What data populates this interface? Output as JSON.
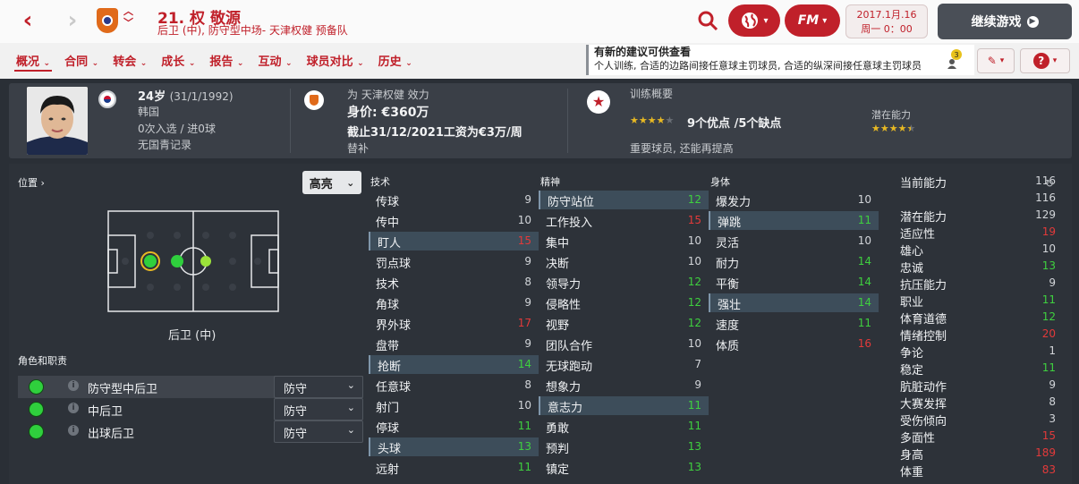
{
  "header": {
    "player_title": "21. 权 敬源",
    "player_subtitle": "后卫 (中), 防守型中场- 天津权健 预备队",
    "brand": "FM",
    "date_line1": "2017.1月.16",
    "date_line2": "周一 0：00",
    "continue_label": "继续游戏"
  },
  "tabs": [
    {
      "label": "概况"
    },
    {
      "label": "合同"
    },
    {
      "label": "转会"
    },
    {
      "label": "成长"
    },
    {
      "label": "报告"
    },
    {
      "label": "互动"
    },
    {
      "label": "球员对比"
    },
    {
      "label": "历史"
    }
  ],
  "notice": {
    "title": "有新的建议可供查看",
    "body": "个人训练, 合适的边路间接任意球主罚球员, 合适的纵深间接任意球主罚球员",
    "count": "3"
  },
  "info": {
    "age": "24岁",
    "dob": "(31/1/1992)",
    "nation": "韩国",
    "caps": "0次入选 / 进0球",
    "youth": "无国青记录",
    "club_line": "为 天津权健 效力",
    "value": "身价: €360万",
    "contract": "截止31/12/2021工资为€3万/周",
    "squad_status": "替补",
    "training_title": "训练概要",
    "strengths": "9个优点 /5个缺点",
    "role_note": "重要球员, 还能再提高",
    "potential_label": "潜在能力",
    "current_stars": 4,
    "potential_stars": 4.5
  },
  "position": {
    "title": "位置 ›",
    "highlight_label": "高亮",
    "position_name": "后卫 (中)",
    "roles_title": "角色和职责",
    "roles": [
      {
        "name": "防守型中后卫",
        "duty": "防守"
      },
      {
        "name": "中后卫",
        "duty": "防守"
      },
      {
        "name": "出球后卫",
        "duty": "防守"
      }
    ]
  },
  "technical": {
    "title": "技术",
    "items": [
      {
        "name": "传球",
        "value": "9",
        "color": "w",
        "hl": false
      },
      {
        "name": "传中",
        "value": "10",
        "color": "w",
        "hl": false
      },
      {
        "name": "盯人",
        "value": "15",
        "color": "r",
        "hl": true
      },
      {
        "name": "罚点球",
        "value": "9",
        "color": "w",
        "hl": false
      },
      {
        "name": "技术",
        "value": "8",
        "color": "w",
        "hl": false
      },
      {
        "name": "角球",
        "value": "9",
        "color": "w",
        "hl": false
      },
      {
        "name": "界外球",
        "value": "17",
        "color": "r",
        "hl": false
      },
      {
        "name": "盘带",
        "value": "9",
        "color": "w",
        "hl": false
      },
      {
        "name": "抢断",
        "value": "14",
        "color": "g",
        "hl": true
      },
      {
        "name": "任意球",
        "value": "8",
        "color": "w",
        "hl": false
      },
      {
        "name": "射门",
        "value": "10",
        "color": "w",
        "hl": false
      },
      {
        "name": "停球",
        "value": "11",
        "color": "g",
        "hl": false
      },
      {
        "name": "头球",
        "value": "13",
        "color": "g",
        "hl": true
      },
      {
        "name": "远射",
        "value": "11",
        "color": "g",
        "hl": false
      }
    ]
  },
  "mental": {
    "title": "精神",
    "items": [
      {
        "name": "防守站位",
        "value": "12",
        "color": "g",
        "hl": true
      },
      {
        "name": "工作投入",
        "value": "15",
        "color": "r",
        "hl": false
      },
      {
        "name": "集中",
        "value": "10",
        "color": "w",
        "hl": false
      },
      {
        "name": "决断",
        "value": "10",
        "color": "w",
        "hl": false
      },
      {
        "name": "领导力",
        "value": "12",
        "color": "g",
        "hl": false
      },
      {
        "name": "侵略性",
        "value": "12",
        "color": "g",
        "hl": false
      },
      {
        "name": "视野",
        "value": "12",
        "color": "g",
        "hl": false
      },
      {
        "name": "团队合作",
        "value": "10",
        "color": "w",
        "hl": false
      },
      {
        "name": "无球跑动",
        "value": "7",
        "color": "w",
        "hl": false
      },
      {
        "name": "想象力",
        "value": "9",
        "color": "w",
        "hl": false
      },
      {
        "name": "意志力",
        "value": "11",
        "color": "g",
        "hl": true
      },
      {
        "name": "勇敢",
        "value": "11",
        "color": "g",
        "hl": false
      },
      {
        "name": "预判",
        "value": "13",
        "color": "g",
        "hl": false
      },
      {
        "name": "镇定",
        "value": "13",
        "color": "g",
        "hl": false
      }
    ]
  },
  "physical": {
    "title": "身体",
    "items": [
      {
        "name": "爆发力",
        "value": "10",
        "color": "w",
        "hl": false
      },
      {
        "name": "弹跳",
        "value": "11",
        "color": "g",
        "hl": true
      },
      {
        "name": "灵活",
        "value": "10",
        "color": "w",
        "hl": false
      },
      {
        "name": "耐力",
        "value": "14",
        "color": "g",
        "hl": false
      },
      {
        "name": "平衡",
        "value": "14",
        "color": "g",
        "hl": false
      },
      {
        "name": "强壮",
        "value": "14",
        "color": "g",
        "hl": true
      },
      {
        "name": "速度",
        "value": "11",
        "color": "g",
        "hl": false
      },
      {
        "name": "体质",
        "value": "16",
        "color": "r",
        "hl": false
      }
    ]
  },
  "hidden": {
    "items": [
      {
        "name": "当前能力",
        "value": "116",
        "color": "w"
      },
      {
        "name": "",
        "value": "116",
        "color": "w"
      },
      {
        "name": "潜在能力",
        "value": "129",
        "color": "w"
      },
      {
        "name": "适应性",
        "value": "19",
        "color": "r"
      },
      {
        "name": "雄心",
        "value": "10",
        "color": "w"
      },
      {
        "name": "忠诚",
        "value": "13",
        "color": "g"
      },
      {
        "name": "抗压能力",
        "value": "9",
        "color": "w"
      },
      {
        "name": "职业",
        "value": "11",
        "color": "g"
      },
      {
        "name": "体育道德",
        "value": "12",
        "color": "g"
      },
      {
        "name": "情绪控制",
        "value": "20",
        "color": "r"
      },
      {
        "name": "争论",
        "value": "1",
        "color": "w"
      },
      {
        "name": "稳定",
        "value": "11",
        "color": "g"
      },
      {
        "name": "肮脏动作",
        "value": "9",
        "color": "w"
      },
      {
        "name": "大赛发挥",
        "value": "8",
        "color": "w"
      },
      {
        "name": "受伤倾向",
        "value": "3",
        "color": "w"
      },
      {
        "name": "多面性",
        "value": "15",
        "color": "r"
      },
      {
        "name": "身高",
        "value": "189",
        "color": "r"
      },
      {
        "name": "体重",
        "value": "83",
        "color": "r"
      }
    ]
  },
  "colors": {
    "accent": "#c0202a",
    "good": "#3fd03f",
    "bad": "#e23a3a",
    "panel": "#3a3f47"
  }
}
